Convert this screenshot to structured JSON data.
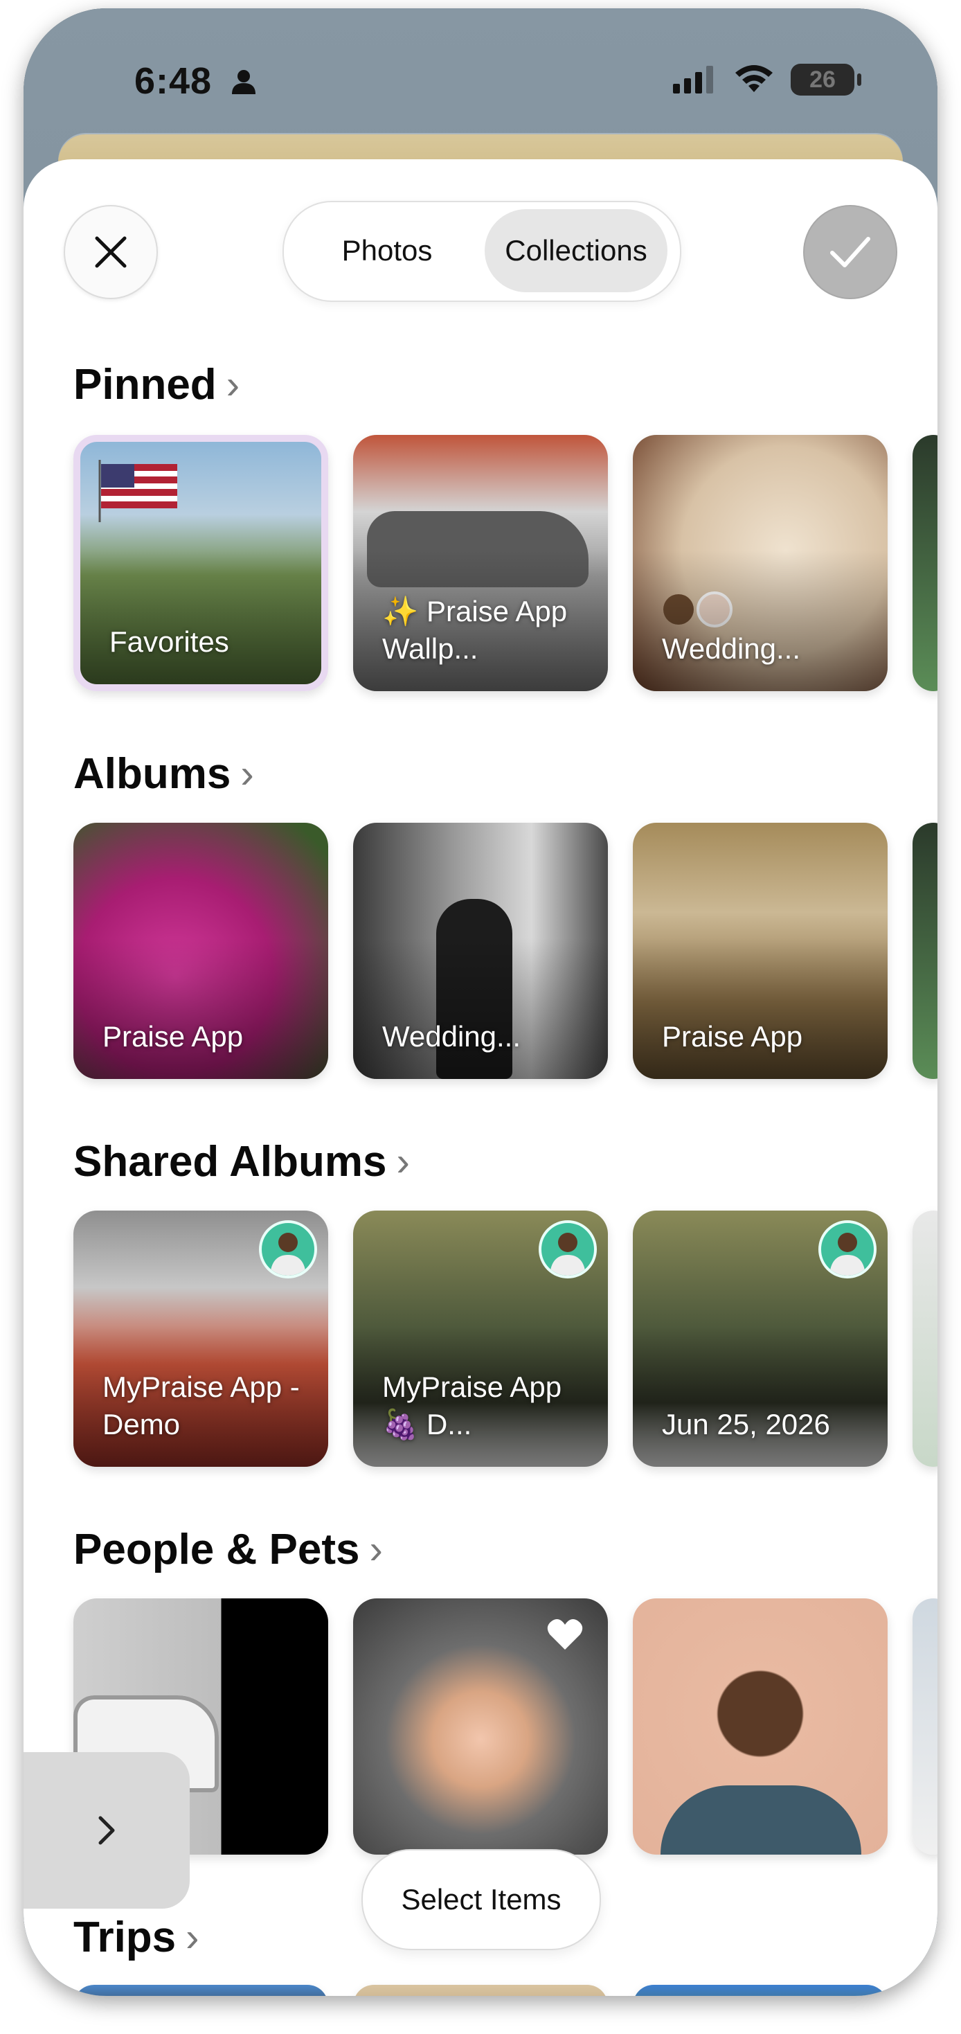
{
  "status": {
    "time": "6:48",
    "battery": "26"
  },
  "header": {
    "segments": [
      "Photos",
      "Collections"
    ],
    "selected_segment": "Collections"
  },
  "sections": {
    "pinned": {
      "title": "Pinned",
      "items": [
        {
          "label": "Favorites"
        },
        {
          "label": "✨ Praise App Wallp..."
        },
        {
          "label": "Wedding..."
        }
      ]
    },
    "albums": {
      "title": "Albums",
      "items": [
        {
          "label": "Praise App"
        },
        {
          "label": "Wedding..."
        },
        {
          "label": "Praise App"
        }
      ]
    },
    "shared_albums": {
      "title": "Shared Albums",
      "items": [
        {
          "label": "MyPraise App - Demo"
        },
        {
          "label": "MyPraise App 🍇 D..."
        },
        {
          "label": "Jun 25, 2026"
        }
      ]
    },
    "people_pets": {
      "title": "People & Pets"
    },
    "trips": {
      "title": "Trips"
    }
  },
  "actions": {
    "select_items": "Select Items"
  },
  "colors": {
    "accent_badge": "#3fbf9c",
    "done_button": "#b5b5b5"
  }
}
